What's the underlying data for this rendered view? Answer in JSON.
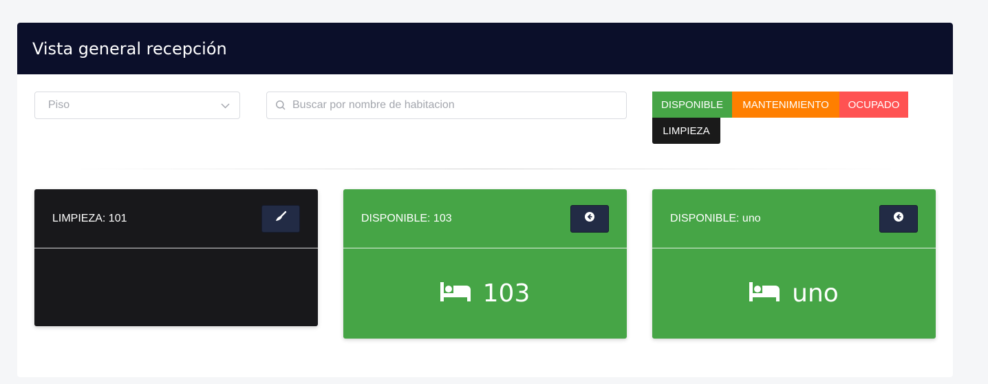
{
  "header": {
    "title": "Vista general recepción"
  },
  "filters": {
    "floor_placeholder": "Piso",
    "search_placeholder": "Buscar por nombre de habitacion"
  },
  "legend": [
    {
      "label": "DISPONIBLE",
      "color": "#46a546"
    },
    {
      "label": "MANTENIMIENTO",
      "color": "#ff7f00"
    },
    {
      "label": "OCUPADO",
      "color": "#ff5252"
    },
    {
      "label": "LIMPIEZA",
      "color": "#1a1a1a"
    }
  ],
  "rooms": [
    {
      "status_label": "LIMPIEZA: 101",
      "room": "",
      "color": "#18181b",
      "action_icon": "broom-icon"
    },
    {
      "status_label": "DISPONIBLE: 103",
      "room": "103",
      "color": "#46a546",
      "action_icon": "arrow-circle-left-icon"
    },
    {
      "status_label": "DISPONIBLE: uno",
      "room": "uno",
      "color": "#46a546",
      "action_icon": "arrow-circle-left-icon"
    }
  ]
}
